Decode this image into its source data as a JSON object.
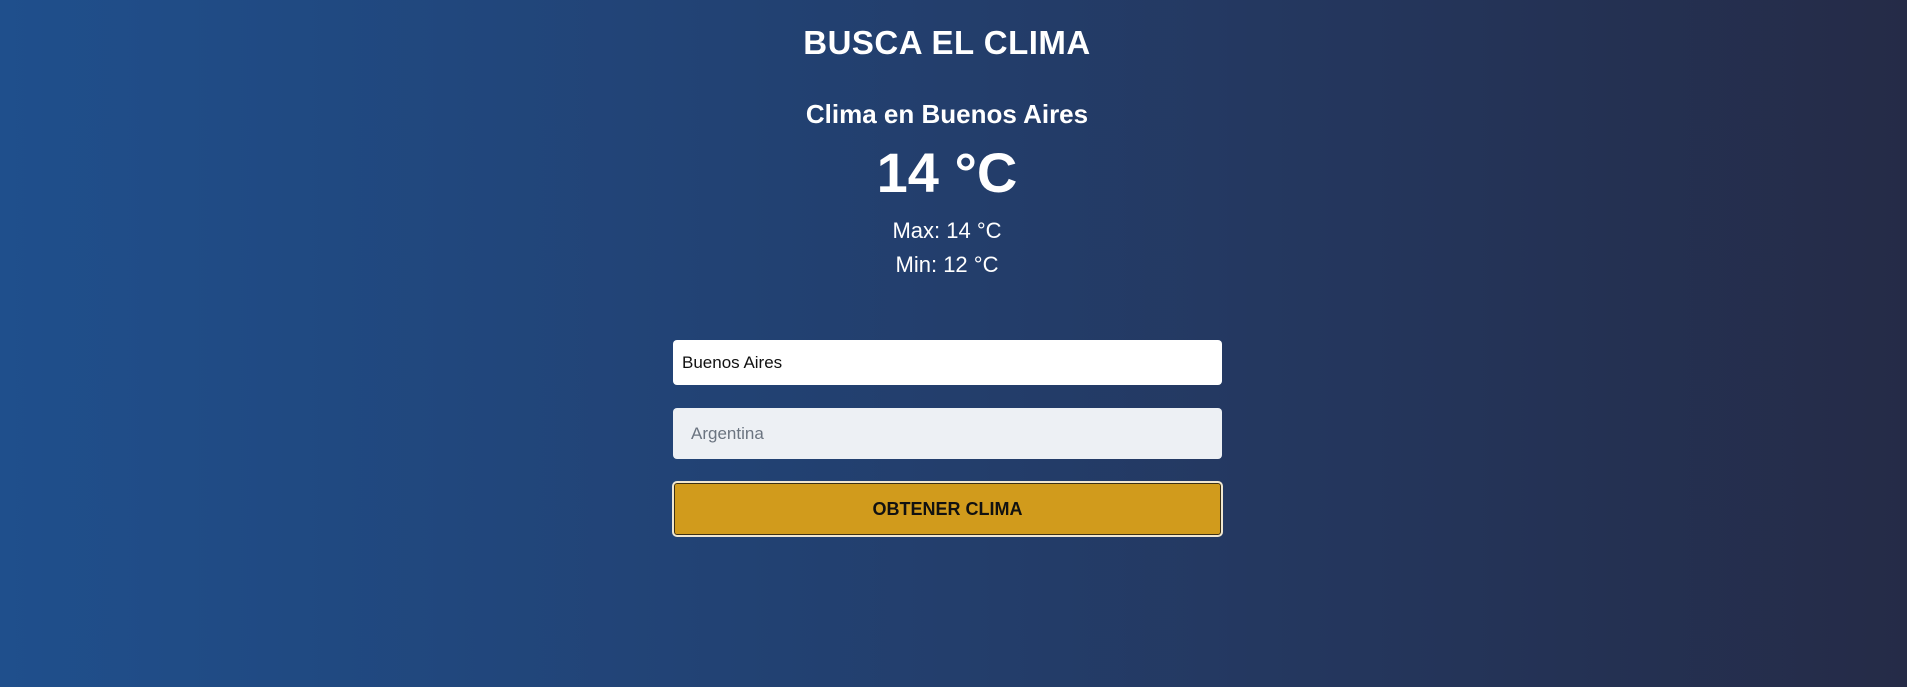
{
  "header": {
    "title": "BUSCA EL CLIMA"
  },
  "weather": {
    "location_heading": "Clima en Buenos Aires",
    "temperature": "14 °C",
    "max": "Max: 14 °C",
    "min": "Min: 12 °C"
  },
  "form": {
    "city_value": "Buenos Aires",
    "country_placeholder": "Argentina",
    "submit_label": "OBTENER CLIMA"
  },
  "colors": {
    "background_start": "#1f4f8c",
    "background_end": "#252b47",
    "button": "#d19b1c"
  }
}
